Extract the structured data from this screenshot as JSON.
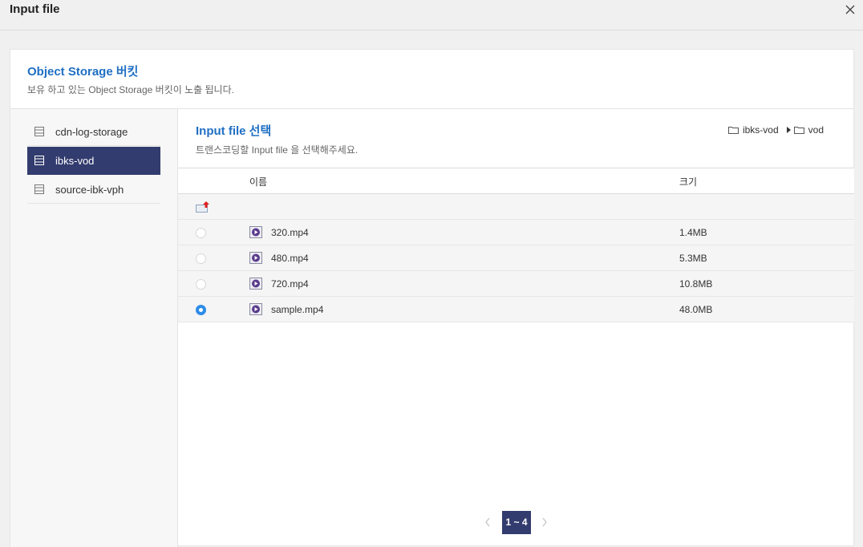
{
  "window": {
    "title": "Input file"
  },
  "bucket_section": {
    "title": "Object Storage 버킷",
    "description": "보유 하고 있는 Object Storage 버킷이 노출 됩니다."
  },
  "buckets": [
    {
      "label": "cdn-log-storage",
      "active": false
    },
    {
      "label": "ibks-vod",
      "active": true
    },
    {
      "label": "source-ibk-vph",
      "active": false
    }
  ],
  "file_section": {
    "title": "Input file 선택",
    "description": "트랜스코딩할 Input file 을 선택해주세요.",
    "breadcrumb": [
      "ibks-vod",
      "vod"
    ]
  },
  "table": {
    "headers": {
      "name": "이름",
      "size": "크기"
    },
    "rows": [
      {
        "name": "320.mp4",
        "size": "1.4MB",
        "selected": false
      },
      {
        "name": "480.mp4",
        "size": "5.3MB",
        "selected": false
      },
      {
        "name": "720.mp4",
        "size": "10.8MB",
        "selected": false
      },
      {
        "name": "sample.mp4",
        "size": "48.0MB",
        "selected": true
      }
    ]
  },
  "pagination": {
    "current": "1 ~ 4"
  },
  "colors": {
    "accent": "#1f6fc4",
    "nav_active": "#333c6e",
    "radio": "#2d8ce8"
  },
  "icons": [
    "close-icon",
    "storage-icon",
    "folder-icon",
    "up-folder-icon",
    "video-file-icon",
    "chevron-left-icon",
    "chevron-right-icon"
  ]
}
